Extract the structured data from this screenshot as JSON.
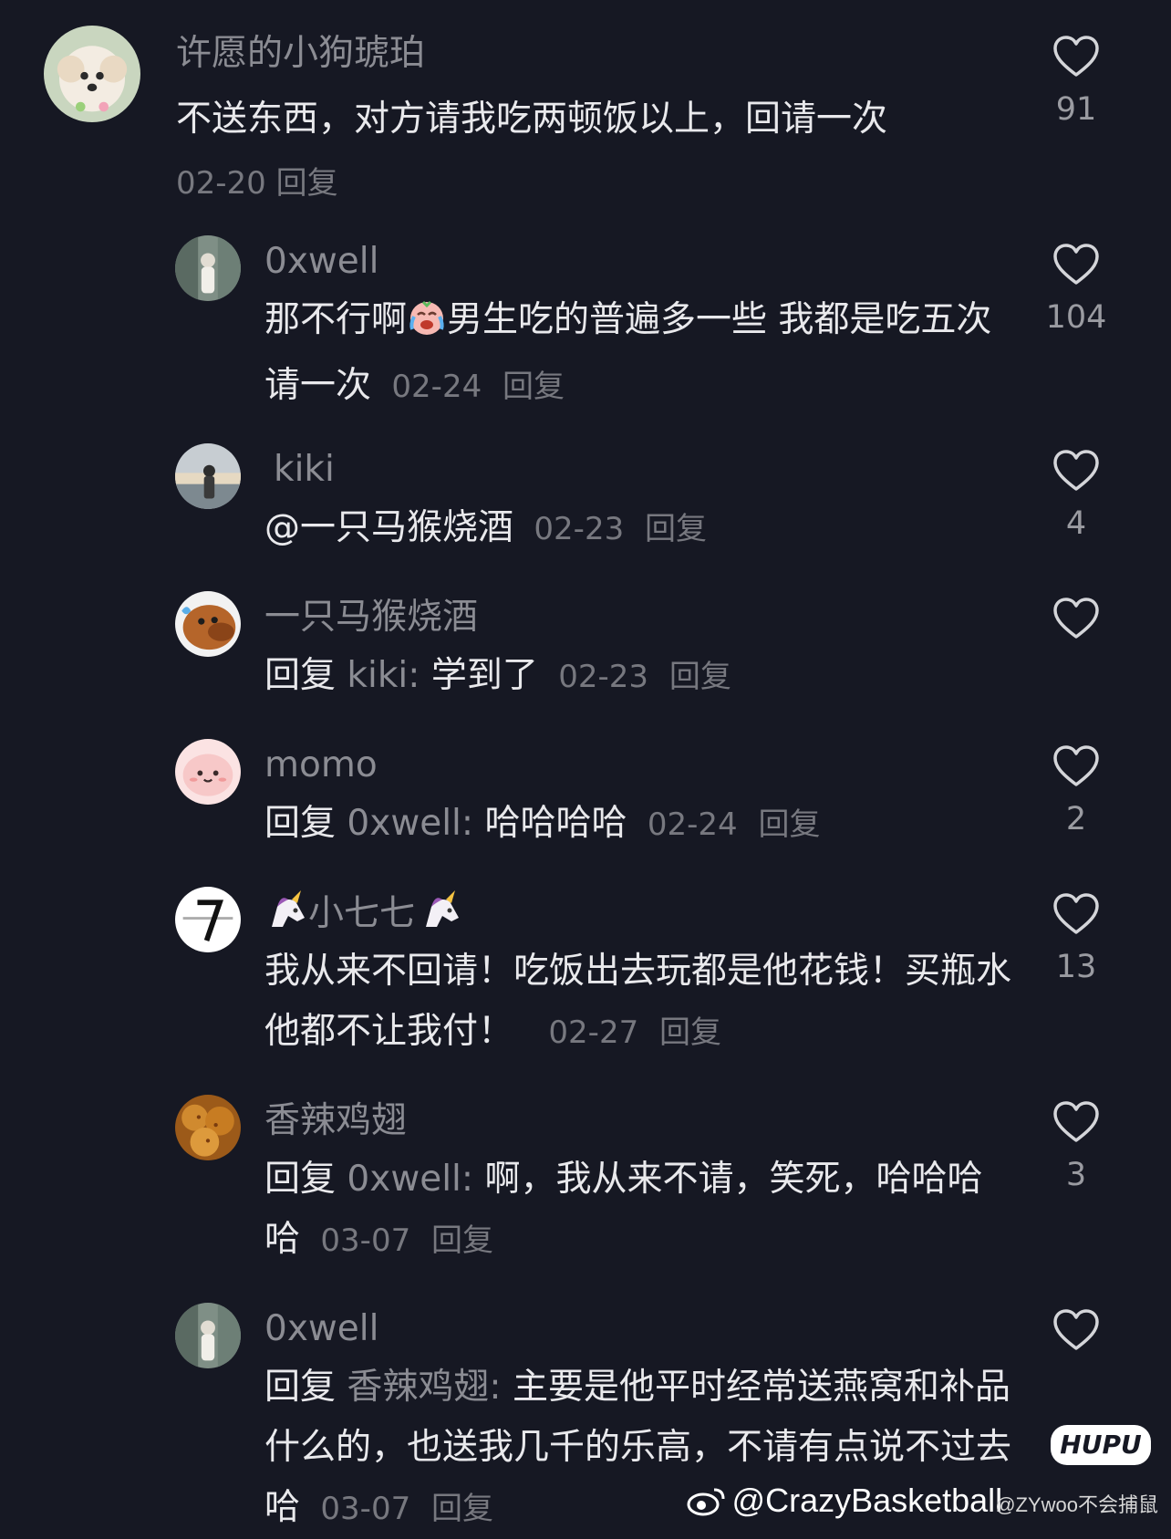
{
  "comments": [
    {
      "username": "许愿的小狗琥珀",
      "text": "不送东西，对方请我吃两顿饭以上，回请一次",
      "date": "02-20",
      "reply_label": "回复",
      "likes": "91"
    },
    {
      "username": "0xwell",
      "text_a": "那不行啊",
      "text_b": "男生吃的普遍多一些 我都是吃五次请一次",
      "date": "02-24",
      "reply_label": "回复",
      "likes": "104"
    },
    {
      "username": "kiki",
      "text": "@一只马猴烧酒",
      "date": "02-23",
      "reply_label": "回复",
      "likes": "4"
    },
    {
      "username": "一只马猴烧酒",
      "reply_prefix": "回复",
      "reply_to": "kiki:",
      "text": "学到了",
      "date": "02-23",
      "reply_label": "回复",
      "likes": ""
    },
    {
      "username": "momo",
      "reply_prefix": "回复",
      "reply_to": "0xwell:",
      "text": "哈哈哈哈",
      "date": "02-24",
      "reply_label": "回复",
      "likes": "2"
    },
    {
      "username": "小七七",
      "text": "我从来不回请！吃饭出去玩都是他花钱！买瓶水他都不让我付！",
      "date": "02-27",
      "reply_label": "回复",
      "likes": "13"
    },
    {
      "username": "香辣鸡翅",
      "reply_prefix": "回复",
      "reply_to": "0xwell:",
      "text": "啊，我从来不请，笑死，哈哈哈哈",
      "date": "03-07",
      "reply_label": "回复",
      "likes": "3"
    },
    {
      "username": "0xwell",
      "reply_prefix": "回复",
      "reply_to": "香辣鸡翅:",
      "text": "主要是他平时经常送燕窝和补品什么的，也送我几千的乐高，不请有点说不过去哈",
      "date": "03-07",
      "reply_label": "回复",
      "likes": ""
    }
  ],
  "watermark": {
    "handle": "@CrazyBasketball",
    "sub": "@ZYwoo不会捕鼠",
    "hupu": "HUPU"
  },
  "icons": {
    "like": "heart-outline-icon",
    "crying_laughing": "crying-face-emoji",
    "unicorn": "unicorn-emoji"
  }
}
